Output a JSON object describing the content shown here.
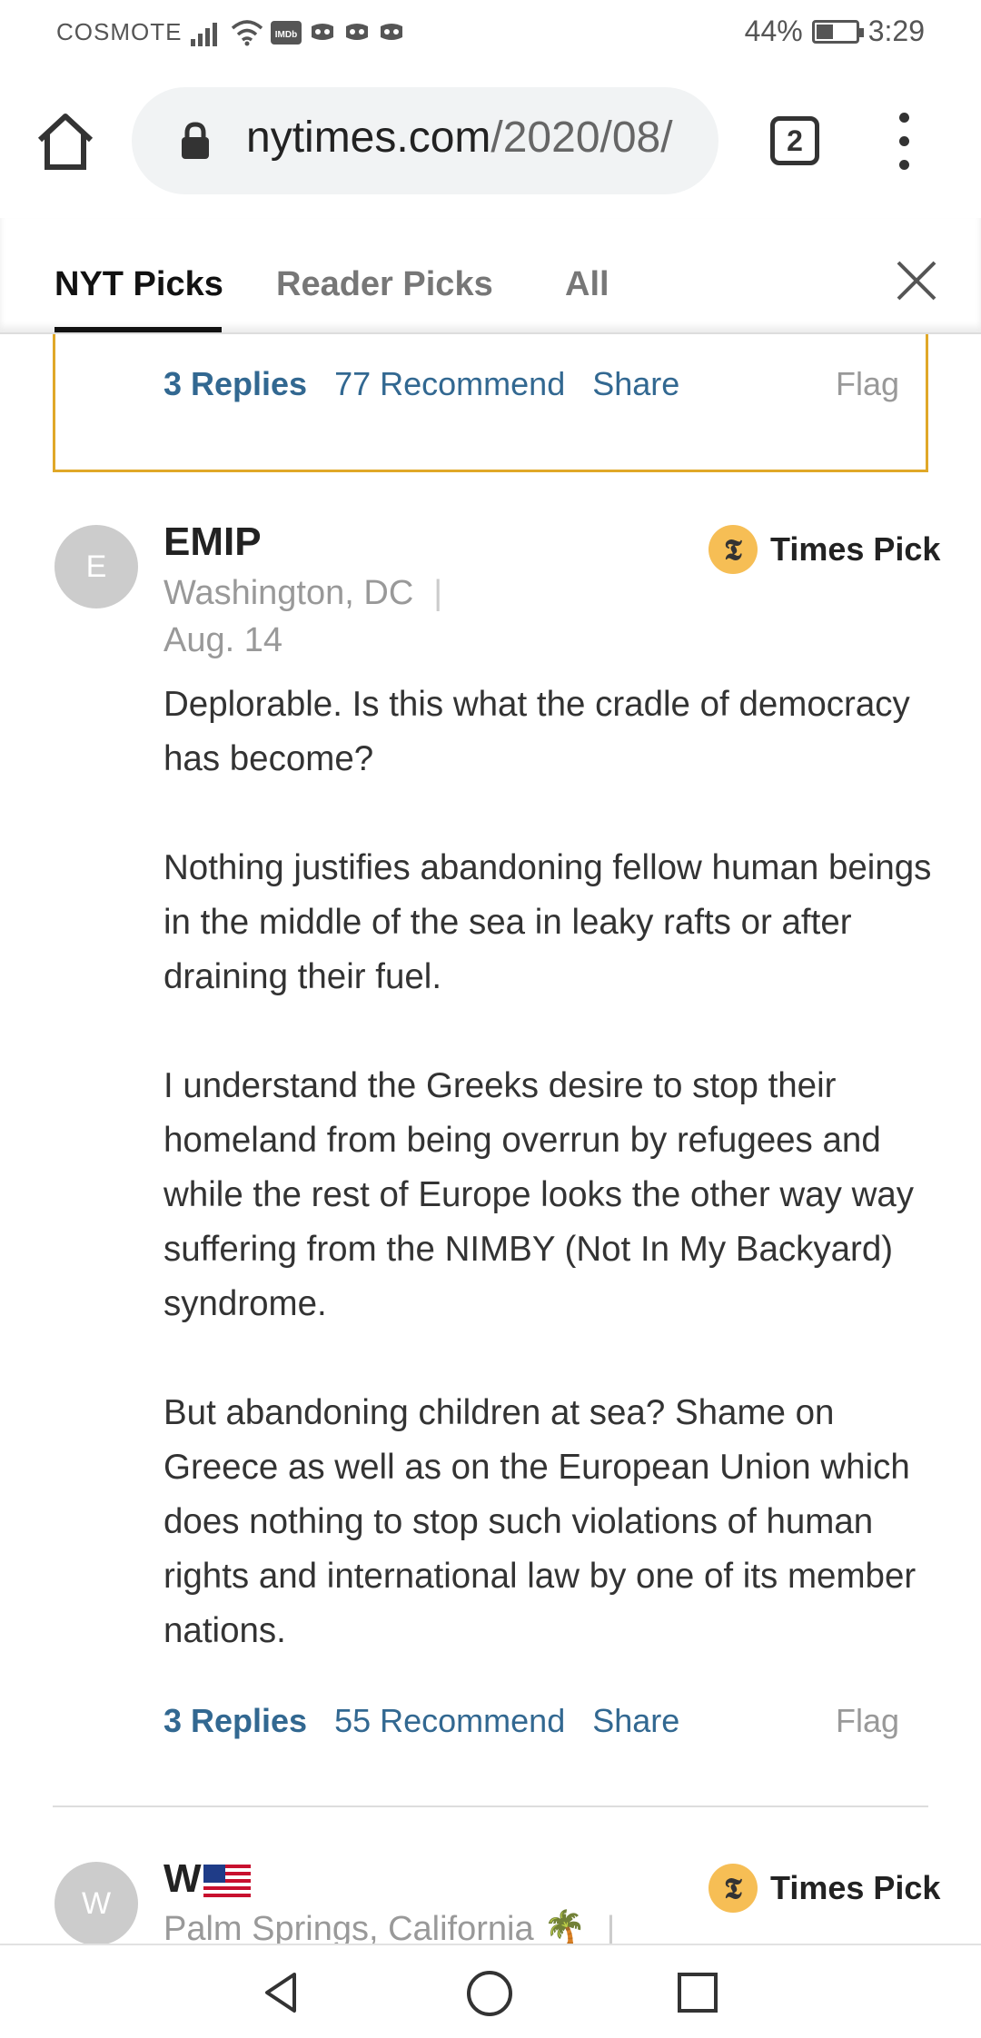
{
  "status_bar": {
    "carrier": "COSMOTE",
    "battery_percent": "44%",
    "battery_level": 0.44,
    "time": "3:29",
    "icons": [
      "signal-icon",
      "wifi-icon",
      "imdb-icon",
      "notification-icon",
      "notification-icon",
      "notification-icon"
    ]
  },
  "browser": {
    "url_domain": "nytimes.com",
    "url_path": "/2020/08/",
    "tab_count": "2"
  },
  "comments_panel": {
    "tabs": [
      {
        "label": "NYT Picks",
        "active": true
      },
      {
        "label": "Reader Picks",
        "active": false
      },
      {
        "label": "All",
        "active": false
      }
    ]
  },
  "previous_comment": {
    "replies": "3 Replies",
    "recommend": "77 Recommend",
    "share": "Share",
    "flag": "Flag"
  },
  "comment": {
    "avatar_letter": "E",
    "author": "EMIP",
    "location": "Washington, DC",
    "separator": "|",
    "date": "Aug. 14",
    "badge": "Times Pick",
    "paragraphs": [
      "Deplorable. Is this what the cradle of democracy has become?",
      "Nothing justifies abandoning fellow human beings in the middle of the sea in leaky rafts or after draining their fuel.",
      "I understand the Greeks desire to stop their homeland from being overrun by refugees and while the rest of Europe looks the other way way suffering from the NIMBY (Not In My Backyard) syndrome.",
      "But abandoning children at sea? Shame on Greece as well as on the European Union which does nothing to stop such violations of human rights and international law by one of its member nations."
    ],
    "replies": "3 Replies",
    "recommend": "55 Recommend",
    "share": "Share",
    "flag": "Flag"
  },
  "next_comment": {
    "avatar_letter": "W",
    "author": "W",
    "author_emoji": "us-flag-icon",
    "location": "Palm Springs, California 🌴",
    "separator": "|",
    "badge": "Times Pick"
  },
  "colors": {
    "accent_link": "#326891",
    "highlight_border": "#e0a828",
    "times_pick_badge": "#f6be55"
  }
}
